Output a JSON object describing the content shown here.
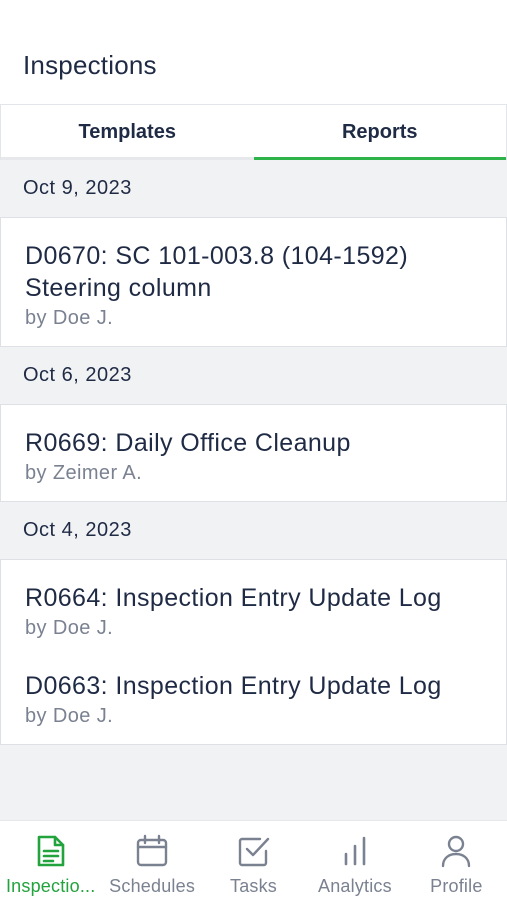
{
  "header": {
    "title": "Inspections"
  },
  "tabs": [
    {
      "label": "Templates",
      "active": false
    },
    {
      "label": "Reports",
      "active": true
    }
  ],
  "groups": [
    {
      "date": "Oct 9, 2023",
      "items": [
        {
          "title": "D0670: SC 101-003.8 (104-1592) Steering column",
          "author": "by Doe J."
        }
      ]
    },
    {
      "date": "Oct 6, 2023",
      "items": [
        {
          "title": "R0669: Daily Office Cleanup",
          "author": "by Zeimer A."
        }
      ]
    },
    {
      "date": "Oct 4, 2023",
      "items": [
        {
          "title": "R0664: Inspection Entry Update Log",
          "author": "by Doe J."
        },
        {
          "title": "D0663: Inspection Entry Update Log",
          "author": "by Doe J."
        }
      ]
    }
  ],
  "bottom_nav": [
    {
      "label": "Inspectio...",
      "icon": "document-icon",
      "active": true
    },
    {
      "label": "Schedules",
      "icon": "calendar-icon",
      "active": false
    },
    {
      "label": "Tasks",
      "icon": "checkbox-icon",
      "active": false
    },
    {
      "label": "Analytics",
      "icon": "bar-chart-icon",
      "active": false
    },
    {
      "label": "Profile",
      "icon": "person-icon",
      "active": false
    }
  ],
  "colors": {
    "accent": "#2db34a",
    "text": "#1f2a44",
    "muted": "#7a8190",
    "background": "#f1f2f4"
  }
}
